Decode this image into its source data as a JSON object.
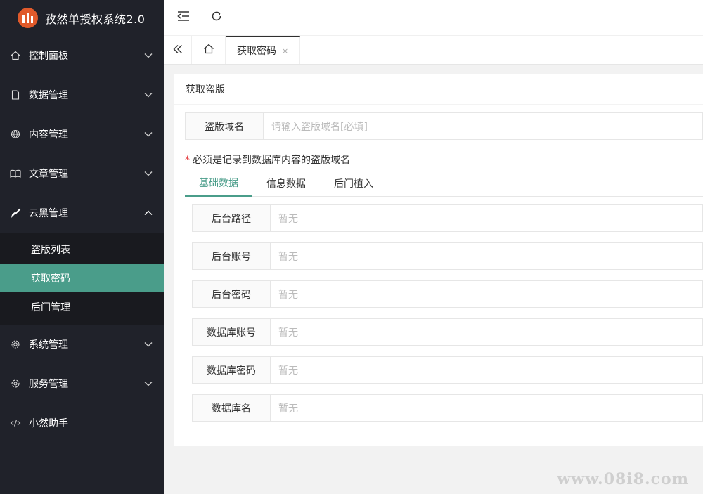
{
  "app": {
    "title": "孜然单授权系统2.0",
    "logo_icon": "bars-logo-icon",
    "accent": "#4a9d8a",
    "sidebar_bg": "#20222a"
  },
  "sidebar": {
    "items": [
      {
        "label": "控制面板",
        "icon": "home-icon"
      },
      {
        "label": "数据管理",
        "icon": "document-icon"
      },
      {
        "label": "内容管理",
        "icon": "globe-icon"
      },
      {
        "label": "文章管理",
        "icon": "book-icon"
      },
      {
        "label": "云黑管理",
        "icon": "brush-icon",
        "expanded": true
      },
      {
        "label": "系统管理",
        "icon": "gear-icon"
      },
      {
        "label": "服务管理",
        "icon": "gear-icon"
      },
      {
        "label": "小然助手",
        "icon": "code-icon"
      }
    ],
    "sub_items": [
      {
        "label": "盗版列表"
      },
      {
        "label": "获取密码",
        "active": true
      },
      {
        "label": "后门管理"
      }
    ]
  },
  "tabs": {
    "active_label": "获取密码",
    "close_glyph": "×"
  },
  "card": {
    "title": "获取盗版",
    "domain_field": {
      "label": "盗版域名",
      "placeholder": "请输入盗版域名[必填]"
    },
    "note_star": "*",
    "note": "必须是记录到数据库内容的盗版域名",
    "subtabs": [
      "基础数据",
      "信息数据",
      "后门植入"
    ],
    "fields": [
      {
        "label": "后台路径",
        "value": "暂无"
      },
      {
        "label": "后台账号",
        "value": "暂无"
      },
      {
        "label": "后台密码",
        "value": "暂无"
      },
      {
        "label": "数据库账号",
        "value": "暂无"
      },
      {
        "label": "数据库密码",
        "value": "暂无"
      },
      {
        "label": "数据库名",
        "value": "暂无"
      }
    ]
  },
  "watermark": "www.08i8.com"
}
